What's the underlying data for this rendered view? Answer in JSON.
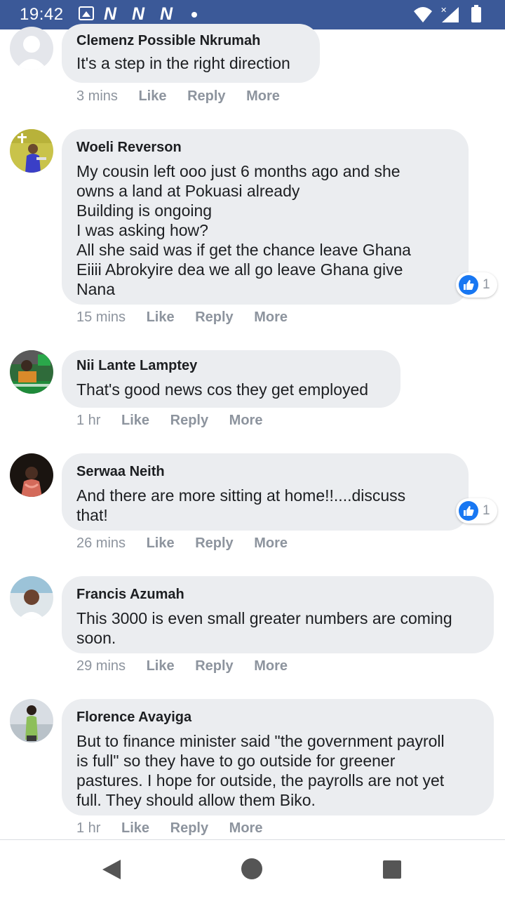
{
  "status_bar": {
    "time": "19:42",
    "icons": [
      "gallery-icon",
      "n-app-icon",
      "n-app-icon",
      "n-app-icon",
      "dot-icon",
      "wifi-icon",
      "signal-icon",
      "battery-icon"
    ],
    "n_letters": [
      "N",
      "N",
      "N"
    ]
  },
  "colors": {
    "status_bar": "#3b5998",
    "bubble": "#ebedf0",
    "meta": "#8d949e",
    "like_blue": "#1877f2"
  },
  "comments": [
    {
      "author": "Clemenz Possible Nkrumah",
      "text": "It's a step in the right direction",
      "time": "3 mins",
      "like": "Like",
      "reply": "Reply",
      "more": "More"
    },
    {
      "author": "Woeli Reverson",
      "text": "My cousin left ooo just 6 months ago and she\nowns a land at Pokuasi already\nBuilding is ongoing\nI was asking how?\nAll she said was if get the chance leave Ghana\nEiiii Abrokyire dea we all go leave Ghana give\nNana",
      "time": "15 mins",
      "like": "Like",
      "reply": "Reply",
      "more": "More",
      "reactions": "1"
    },
    {
      "author": "Nii Lante Lamptey",
      "text": "That's good news cos they get employed",
      "time": "1 hr",
      "like": "Like",
      "reply": "Reply",
      "more": "More"
    },
    {
      "author": "Serwaa Neith",
      "text": "And there are more sitting at home!!....discuss\nthat!",
      "time": "26 mins",
      "like": "Like",
      "reply": "Reply",
      "more": "More",
      "reactions": "1"
    },
    {
      "author": "Francis Azumah",
      "text": "This 3000 is even small greater numbers are coming\nsoon.",
      "time": "29 mins",
      "like": "Like",
      "reply": "Reply",
      "more": "More"
    },
    {
      "author": "Florence Avayiga",
      "text": "But to finance minister said \"the government payroll\nis full\" so they have to go outside for greener\npastures. I hope for outside, the payrolls are not yet\nfull. They should allow them Biko.",
      "time": "1 hr",
      "like": "Like",
      "reply": "Reply",
      "more": "More"
    }
  ],
  "nav": {
    "icons": [
      "back-icon",
      "home-icon",
      "recents-icon"
    ]
  }
}
